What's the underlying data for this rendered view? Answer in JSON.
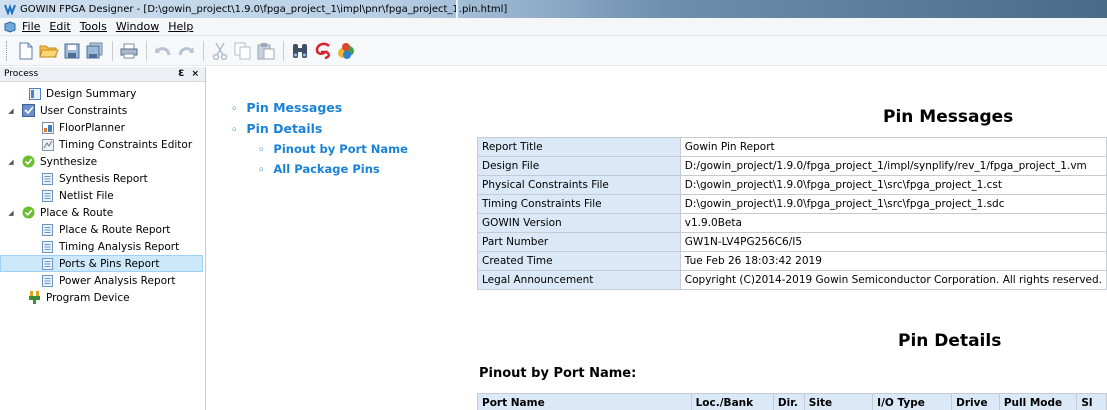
{
  "window": {
    "title": "GOWIN FPGA Designer - [D:\\gowin_project\\1.9.0\\fpga_project_1\\impl\\pnr\\fpga_project_1.pin.html]"
  },
  "menu": [
    "File",
    "Edit",
    "Tools",
    "Window",
    "Help"
  ],
  "toolbar": {
    "icons": [
      "new-file-icon",
      "open-folder-icon",
      "save-icon",
      "save-all-icon",
      "print-icon",
      "undo-icon",
      "redo-icon",
      "cut-icon",
      "copy-icon",
      "paste-icon",
      "find-icon",
      "gowin-logo-icon",
      "cloud-icon"
    ]
  },
  "process": {
    "title": "Process",
    "controls": "Ɛ ×",
    "items": [
      {
        "label": "Design Summary"
      },
      {
        "label": "User Constraints"
      },
      {
        "label": "FloorPlanner"
      },
      {
        "label": "Timing Constraints Editor"
      },
      {
        "label": "Synthesize"
      },
      {
        "label": "Synthesis Report"
      },
      {
        "label": "Netlist File"
      },
      {
        "label": "Place & Route"
      },
      {
        "label": "Place & Route Report"
      },
      {
        "label": "Timing Analysis Report"
      },
      {
        "label": "Ports & Pins Report"
      },
      {
        "label": "Power Analysis Report"
      },
      {
        "label": "Program Device"
      }
    ]
  },
  "nav": {
    "pin_messages": "Pin Messages",
    "pin_details": "Pin Details",
    "pinout_by_port": "Pinout by Port Name",
    "all_package_pins": "All Package Pins"
  },
  "pin_messages": {
    "heading": "Pin Messages",
    "rows": [
      {
        "key": "Report Title",
        "value": "Gowin Pin Report"
      },
      {
        "key": "Design File",
        "value": "D:/gowin_project/1.9.0/fpga_project_1/impl/synplify/rev_1/fpga_project_1.vm"
      },
      {
        "key": "Physical Constraints File",
        "value": "D:\\gowin_project\\1.9.0\\fpga_project_1\\src\\fpga_project_1.cst"
      },
      {
        "key": "Timing Constraints File",
        "value": "D:\\gowin_project\\1.9.0\\fpga_project_1\\src\\fpga_project_1.sdc"
      },
      {
        "key": "GOWIN Version",
        "value": "v1.9.0Beta"
      },
      {
        "key": "Part Number",
        "value": "GW1N-LV4PG256C6/I5"
      },
      {
        "key": "Created Time",
        "value": "Tue Feb 26 18:03:42 2019"
      },
      {
        "key": "Legal Announcement",
        "value": "Copyright (C)2014-2019 Gowin Semiconductor Corporation. All rights reserved."
      }
    ]
  },
  "pin_details": {
    "heading": "Pin Details",
    "subheading": "Pinout by Port Name:",
    "columns": [
      "Port Name",
      "Loc./Bank",
      "Dir.",
      "Site",
      "I/O Type",
      "Drive",
      "Pull Mode",
      "Sl"
    ]
  }
}
